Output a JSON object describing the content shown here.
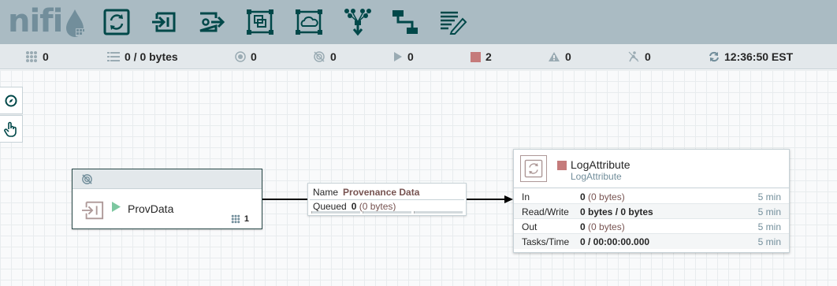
{
  "app": {
    "logo_text": "nifi"
  },
  "toolbar": {
    "tools": [
      {
        "name": "processor"
      },
      {
        "name": "input-port"
      },
      {
        "name": "output-port"
      },
      {
        "name": "process-group"
      },
      {
        "name": "remote-process-group"
      },
      {
        "name": "funnel"
      },
      {
        "name": "template"
      },
      {
        "name": "label"
      }
    ]
  },
  "status": {
    "active_threads": "0",
    "queued": "0 / 0 bytes",
    "transmitting": "0",
    "not_transmitting": "0",
    "running": "0",
    "stopped": "2",
    "invalid": "0",
    "disabled": "0",
    "last_refresh": "12:36:50 EST"
  },
  "port": {
    "name": "ProvData",
    "queued_count": "1"
  },
  "connection": {
    "name_label": "Name",
    "name_value": "Provenance Data",
    "queued_label": "Queued",
    "queued_count": "0",
    "queued_size": "(0 bytes)"
  },
  "processor": {
    "name": "LogAttribute",
    "type": "LogAttribute",
    "stats": [
      {
        "key": "In",
        "value": "0",
        "size": "(0 bytes)",
        "time": "5 min"
      },
      {
        "key": "Read/Write",
        "value": "0 bytes / 0 bytes",
        "size": "",
        "time": "5 min"
      },
      {
        "key": "Out",
        "value": "0",
        "size": "(0 bytes)",
        "time": "5 min"
      },
      {
        "key": "Tasks/Time",
        "value": "0 / 00:00:00.000",
        "size": "",
        "time": "5 min"
      }
    ]
  },
  "colors": {
    "header": "#aabbc3",
    "icon": "#004849",
    "stopped": "#c57b7b",
    "accent_text": "#775351",
    "muted": "#728e9b"
  }
}
